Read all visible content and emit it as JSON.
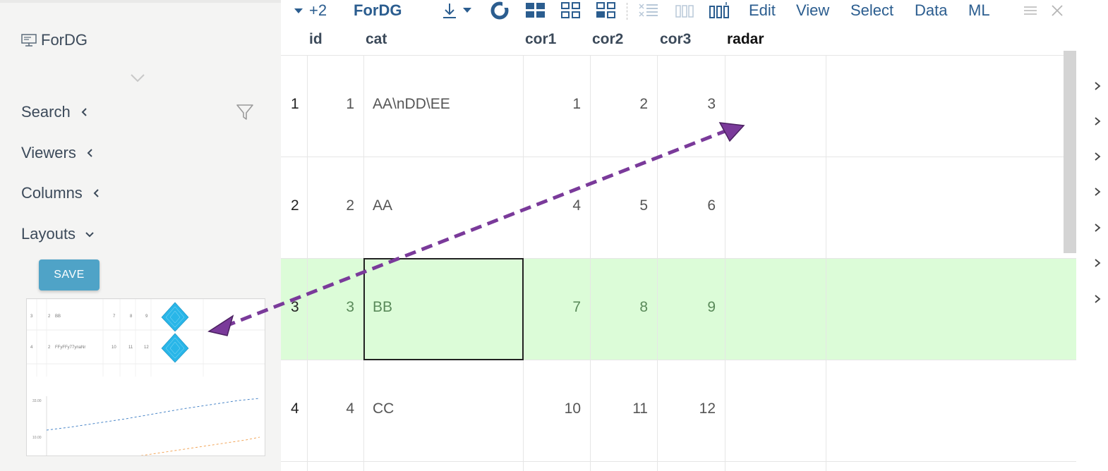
{
  "sidebar": {
    "title": "ForDG",
    "sections": [
      {
        "label": "Search",
        "state": "collapsed"
      },
      {
        "label": "Viewers",
        "state": "collapsed"
      },
      {
        "label": "Columns",
        "state": "collapsed"
      },
      {
        "label": "Layouts",
        "state": "expanded"
      }
    ],
    "save_label": "SAVE"
  },
  "thumbnail": {
    "rows": [
      {
        "rownum": "3",
        "id": "2",
        "cat": "BB",
        "v1": "7",
        "v2": "8",
        "v3": "9"
      },
      {
        "rownum": "4",
        "id": "2",
        "cat": "FFyFFy77ynaNr",
        "v1": "10",
        "v2": "11",
        "v3": "12"
      }
    ],
    "axis_top": "33.00",
    "axis_bottom": "10.00"
  },
  "toolbar": {
    "more_label": "+2",
    "table_name": "ForDG",
    "menus": [
      "Edit",
      "View",
      "Select",
      "Data",
      "ML"
    ]
  },
  "grid": {
    "columns": [
      "id",
      "cat",
      "cor1",
      "cor2",
      "cor3",
      "radar"
    ],
    "rows": [
      {
        "num": "1",
        "id": "1",
        "cat": "AA\\nDD\\EE",
        "cor1": "1",
        "cor2": "2",
        "cor3": "3"
      },
      {
        "num": "2",
        "id": "2",
        "cat": "AA",
        "cor1": "4",
        "cor2": "5",
        "cor3": "6"
      },
      {
        "num": "3",
        "id": "3",
        "cat": "BB",
        "cor1": "7",
        "cor2": "8",
        "cor3": "9"
      },
      {
        "num": "4",
        "id": "4",
        "cat": "CC",
        "cor1": "10",
        "cor2": "11",
        "cor3": "12"
      }
    ],
    "selected_row": 3,
    "current_cell": {
      "row": 3,
      "column": "cat"
    }
  },
  "colors": {
    "accent": "#2b5d8f",
    "save_button": "#4fa3c7",
    "selected_row": "#dcfcd8",
    "annotation_arrow": "#7a3a9a",
    "radar_glyph": "#29b6e8"
  }
}
